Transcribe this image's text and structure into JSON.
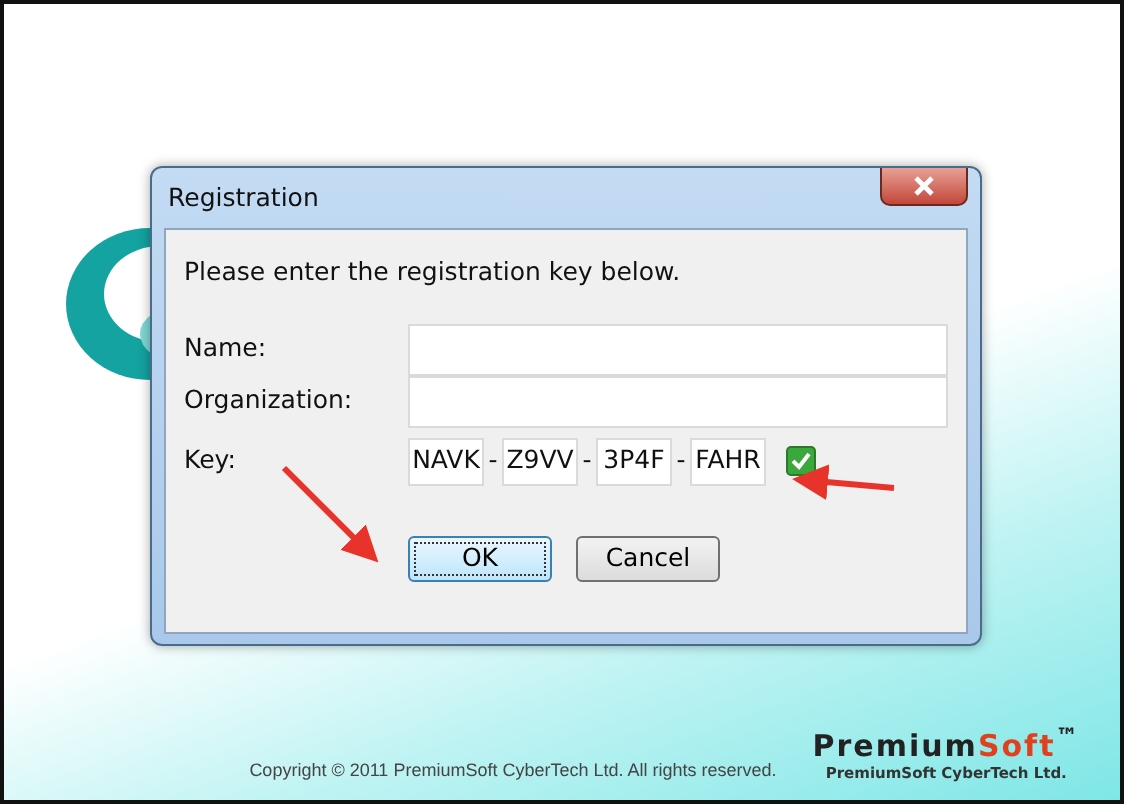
{
  "dialog": {
    "title": "Registration",
    "instruction": "Please enter the registration key below.",
    "fields": [
      {
        "label": "Name:"
      },
      {
        "label": "Organization:"
      }
    ],
    "key": {
      "label": "Key:",
      "segments": [
        "NAVK",
        "Z9VV",
        "3P4F",
        "FAHR"
      ],
      "separator": "-",
      "valid": true
    },
    "buttons": [
      {
        "label": "OK",
        "focused": true
      },
      {
        "label": "Cancel",
        "focused": false
      }
    ]
  },
  "footer": {
    "copyright": "Copyright © 2011 PremiumSoft CyberTech Ltd. All rights reserved.",
    "logo_main": "Premium",
    "logo_accent": "Soft",
    "logo_mark": "™",
    "logo_sub": "PremiumSoft CyberTech Ltd."
  }
}
